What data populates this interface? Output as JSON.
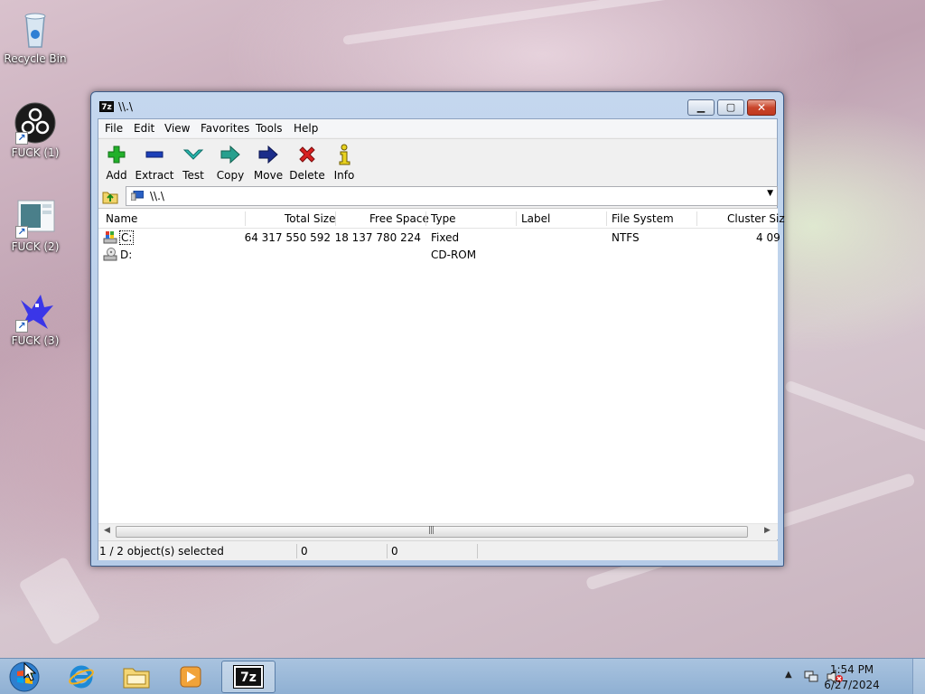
{
  "desktop": {
    "icons": [
      {
        "label": "Recycle Bin"
      },
      {
        "label": "FUCK (1)"
      },
      {
        "label": "FUCK (2)"
      },
      {
        "label": "FUCK (3)"
      }
    ]
  },
  "window": {
    "title": "\\\\.\\",
    "app_icon_text": "7z",
    "menu": [
      "File",
      "Edit",
      "View",
      "Favorites",
      "Tools",
      "Help"
    ],
    "toolbar": {
      "add": "Add",
      "extract": "Extract",
      "test": "Test",
      "copy": "Copy",
      "move": "Move",
      "delete": "Delete",
      "info": "Info"
    },
    "address": "\\\\.\\",
    "columns": [
      "Name",
      "Total Size",
      "Free Space",
      "Type",
      "Label",
      "File System",
      "Cluster Siz"
    ],
    "rows": [
      {
        "name": "C:",
        "total": "64 317 550 592",
        "free": "18 137 780 224",
        "type": "Fixed",
        "label": "",
        "fs": "NTFS",
        "cluster": "4 09"
      },
      {
        "name": "D:",
        "total": "",
        "free": "",
        "type": "CD-ROM",
        "label": "",
        "fs": "",
        "cluster": ""
      }
    ],
    "status": {
      "selected": "1 / 2 object(s) selected",
      "size1": "0",
      "size2": "0"
    }
  },
  "taskbar": {
    "active_app_text": "7z",
    "time": "1:54 PM",
    "date": "6/27/2024"
  },
  "colors": {
    "add_green": "#22b02a",
    "extract_blue": "#1c3fb8",
    "test_teal": "#27b8b0",
    "move_navy": "#1b2c8a",
    "delete_red": "#d92020",
    "info_yellow": "#e8d21f"
  }
}
